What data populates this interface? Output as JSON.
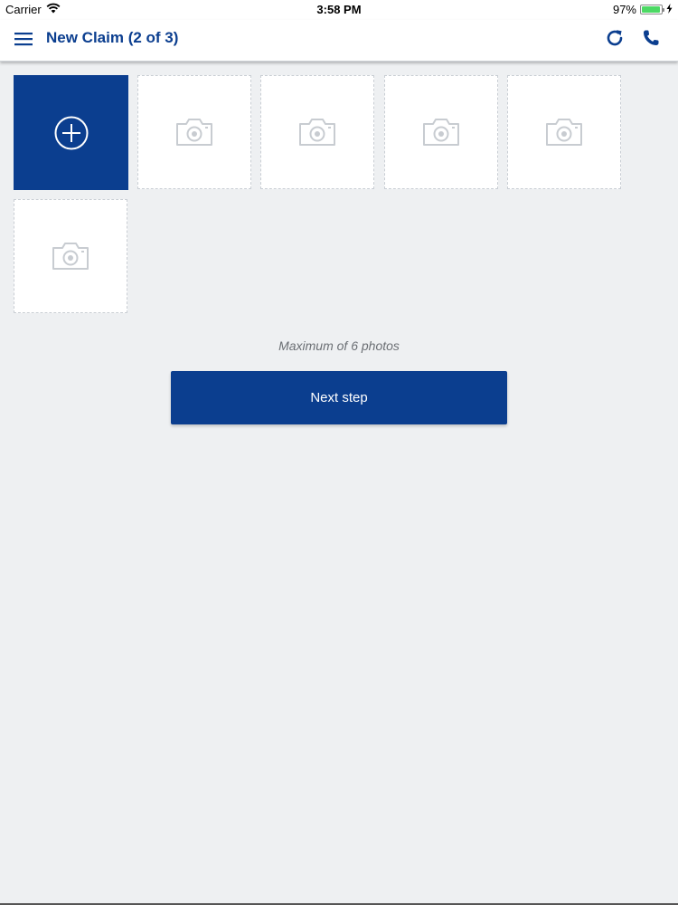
{
  "status_bar": {
    "carrier": "Carrier",
    "time": "3:58 PM",
    "battery": "97%",
    "battery_level": 0.97
  },
  "nav": {
    "title": "New Claim (2 of 3)",
    "icons": [
      "menu-icon",
      "refresh-icon",
      "phone-icon"
    ]
  },
  "photos": {
    "add_icon": "plus-circle-icon",
    "slot_icon": "camera-icon",
    "slots": 6
  },
  "footer": {
    "max_note": "Maximum of 6 photos",
    "next_label": "Next step"
  },
  "colors": {
    "primary": "#0b3e8f",
    "background": "#eef0f2",
    "placeholder_icon": "#c8ccd1"
  }
}
